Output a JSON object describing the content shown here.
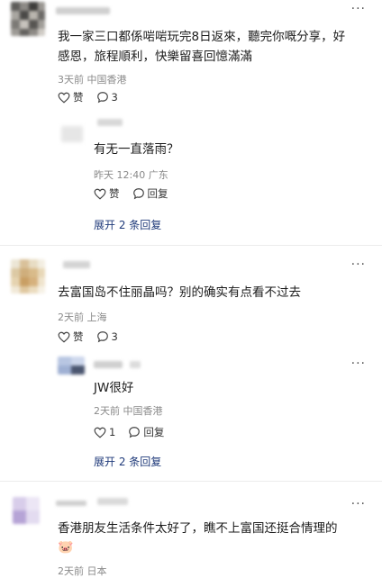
{
  "comments": [
    {
      "text_lines": [
        "我一家三口都係啱啱玩完8日返來，聽完你嘅分享，好",
        "感恩，旅程順利，快樂留喜回憶滿滿"
      ],
      "meta": "3天前  中国香港",
      "like_label": "赞",
      "reply_count": "3",
      "replies": [
        {
          "text": "有无一直落雨？",
          "meta": "昨天 12:40  广东",
          "like_label": "赞",
          "reply_label": "回复"
        }
      ],
      "expand_label": "展开 2 条回复"
    },
    {
      "text_lines": [
        "去富国岛不住丽晶吗？别的确实有点看不过去"
      ],
      "meta": "2天前  上海",
      "like_label": "赞",
      "reply_count": "3",
      "replies": [
        {
          "text": "JW很好",
          "meta": "2天前  中国香港",
          "like_count": "1",
          "reply_label": "回复"
        }
      ],
      "expand_label": "展开 2 条回复"
    },
    {
      "text_lines": [
        "香港朋友生活条件太好了，瞧不上富国还挺合情理的"
      ],
      "emoji": "🐷",
      "meta": "2天前  日本"
    }
  ],
  "colors": {
    "link": "#1f3a7a",
    "meta": "#8a8a8a"
  }
}
